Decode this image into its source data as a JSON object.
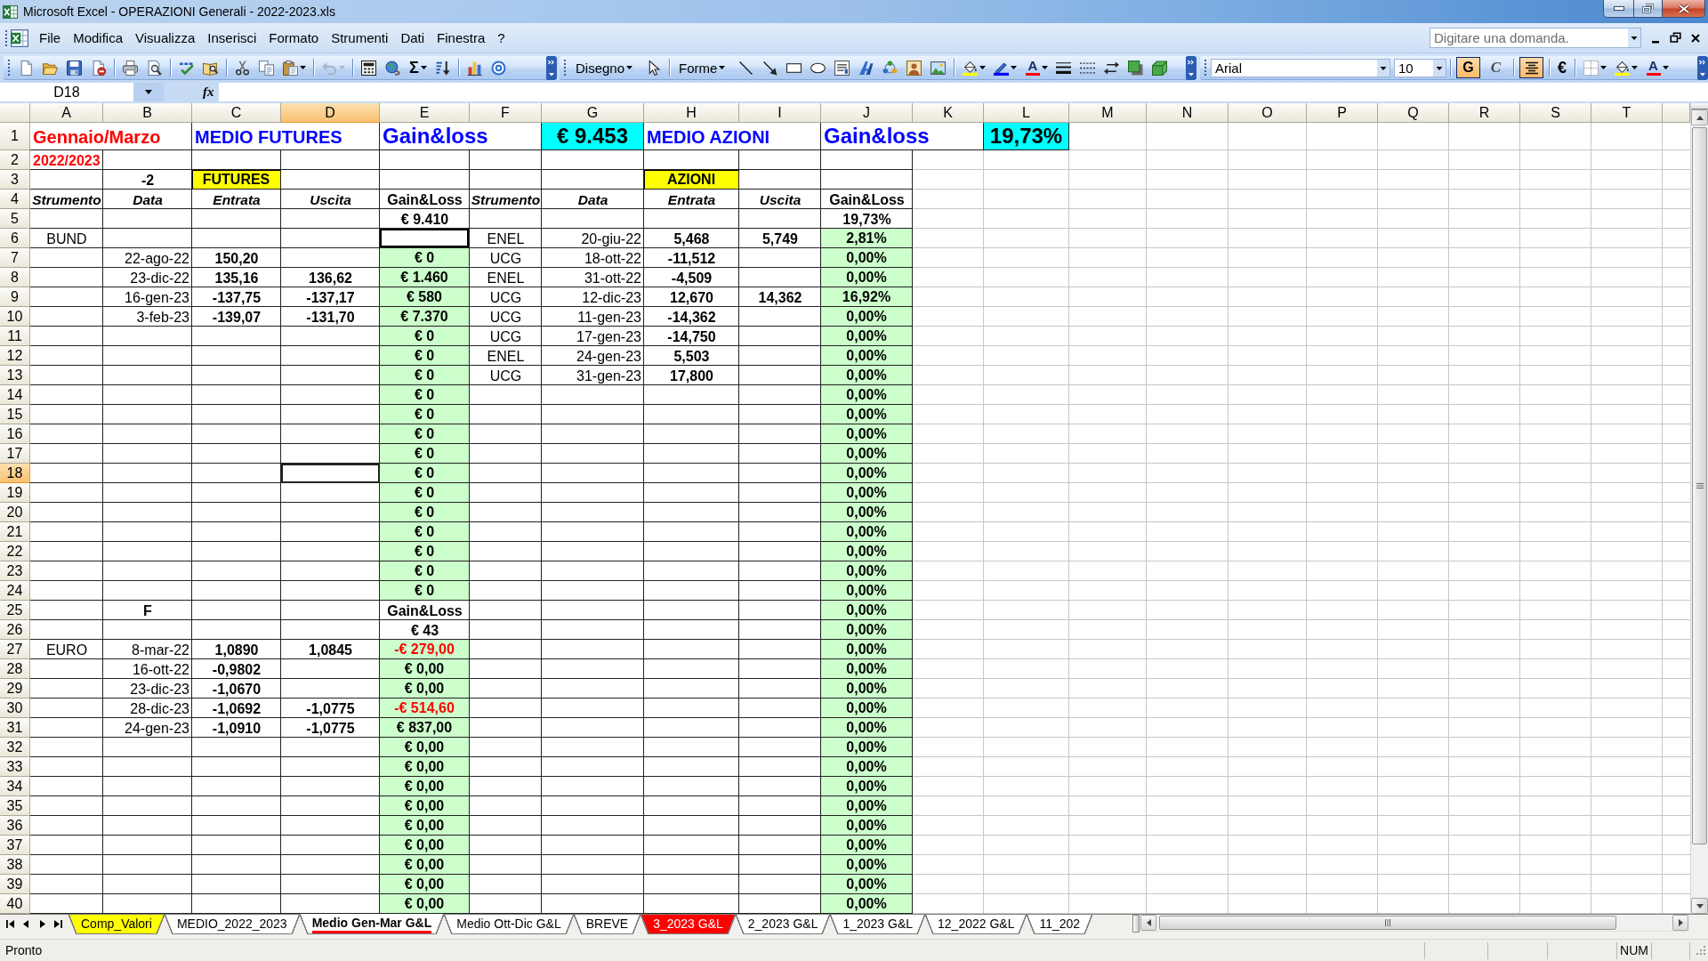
{
  "window": {
    "title": "Microsoft Excel - OPERAZIONI Generali - 2022-2023.xls"
  },
  "menu": {
    "items": [
      "File",
      "Modifica",
      "Visualizza",
      "Inserisci",
      "Formato",
      "Strumenti",
      "Dati",
      "Finestra",
      "?"
    ],
    "help_search": {
      "placeholder": "Digitare una domanda."
    }
  },
  "toolbars": {
    "standard": {
      "undo": {
        "disabled": true
      },
      "sum": "Σ"
    },
    "drawing": {
      "draw_menu": "Disegno",
      "shapes_menu": "Forme",
      "font_color": "A"
    },
    "formatting": {
      "font": "Arial",
      "font_size": "10",
      "bold": {
        "label": "G",
        "on": true
      },
      "italic": {
        "label": "C",
        "on": false
      },
      "center": {
        "on": true
      },
      "currency": "€",
      "font_color": "A"
    }
  },
  "formula_bar": {
    "name_box": "D18",
    "function_label": "fx"
  },
  "sheet": {
    "columns": [
      {
        "label": "A",
        "selected": false
      },
      {
        "label": "B",
        "selected": false
      },
      {
        "label": "C",
        "selected": false
      },
      {
        "label": "D",
        "selected": true
      },
      {
        "label": "E",
        "selected": false
      },
      {
        "label": "F",
        "selected": false
      },
      {
        "label": "G",
        "selected": false
      },
      {
        "label": "H",
        "selected": false
      },
      {
        "label": "I",
        "selected": false
      },
      {
        "label": "J",
        "selected": false
      },
      {
        "label": "K",
        "selected": false
      },
      {
        "label": "L",
        "selected": false
      },
      {
        "label": "M",
        "selected": false
      },
      {
        "label": "N",
        "selected": false
      },
      {
        "label": "O",
        "selected": false
      },
      {
        "label": "P",
        "selected": false
      },
      {
        "label": "Q",
        "selected": false
      },
      {
        "label": "R",
        "selected": false
      },
      {
        "label": "S",
        "selected": false
      },
      {
        "label": "T",
        "selected": false
      }
    ],
    "rows": [
      {
        "label": "1",
        "selected": false,
        "cells": [
          {
            "kind": "period",
            "text": "Gennaio/Marzo"
          },
          "",
          {
            "kind": "section",
            "text": "MEDIO FUTURES"
          },
          "",
          {
            "kind": "gainloss",
            "text": "Gain&loss"
          },
          "",
          {
            "kind": "total",
            "text": "€ 9.453"
          },
          {
            "kind": "section",
            "text": "MEDIO AZIONI"
          },
          "",
          {
            "kind": "gainloss",
            "text": "Gain&loss"
          },
          "",
          {
            "kind": "total",
            "text": "19,73%"
          }
        ]
      },
      {
        "label": "2",
        "selected": false,
        "cells": [
          {
            "kind": "year",
            "text": "2022/2023"
          }
        ]
      },
      {
        "label": "3",
        "selected": false,
        "cells": [
          "",
          {
            "kind": "label",
            "text": "-2"
          },
          {
            "kind": "tag",
            "text": "FUTURES"
          },
          "",
          "",
          "",
          "",
          {
            "kind": "tag",
            "text": "AZIONI"
          }
        ]
      },
      {
        "label": "4",
        "selected": false,
        "cells": [
          {
            "kind": "heading",
            "text": "Strumento"
          },
          {
            "kind": "heading",
            "text": "Data"
          },
          {
            "kind": "heading",
            "text": "Entrata"
          },
          {
            "kind": "heading",
            "text": "Uscita"
          },
          {
            "kind": "label",
            "text": "Gain&Loss"
          },
          {
            "kind": "heading",
            "text": "Strumento"
          },
          {
            "kind": "heading",
            "text": "Data"
          },
          {
            "kind": "heading",
            "text": "Entrata"
          },
          {
            "kind": "heading",
            "text": "Uscita"
          },
          {
            "kind": "label",
            "text": "Gain&Loss"
          }
        ]
      },
      {
        "label": "5",
        "selected": false,
        "cells": [
          "",
          "",
          "",
          "",
          {
            "kind": "label",
            "text": "€ 9.410"
          },
          "",
          "",
          "",
          "",
          {
            "kind": "label",
            "text": "19,73%"
          }
        ]
      },
      {
        "label": "6",
        "selected": false,
        "cells": [
          {
            "kind": "text",
            "text": "BUND"
          },
          "",
          "",
          "",
          {
            "kind": "frame"
          },
          {
            "kind": "text",
            "text": "ENEL"
          },
          {
            "kind": "date",
            "text": "20-giu-22"
          },
          {
            "kind": "number",
            "text": "5,468"
          },
          {
            "kind": "number",
            "text": "5,749"
          },
          {
            "kind": "percent",
            "text": "2,81%"
          }
        ]
      },
      {
        "label": "7",
        "selected": false,
        "cells": [
          "",
          {
            "kind": "date",
            "text": "22-ago-22"
          },
          {
            "kind": "number",
            "text": "150,20"
          },
          "",
          {
            "kind": "gain",
            "text": "€ 0"
          },
          {
            "kind": "text",
            "text": "UCG"
          },
          {
            "kind": "date",
            "text": "18-ott-22"
          },
          {
            "kind": "number",
            "text": "-11,512"
          },
          "",
          {
            "kind": "percent",
            "text": "0,00%"
          }
        ]
      },
      {
        "label": "8",
        "selected": false,
        "cells": [
          "",
          {
            "kind": "date",
            "text": "23-dic-22"
          },
          {
            "kind": "number",
            "text": "135,16"
          },
          {
            "kind": "number",
            "text": "136,62"
          },
          {
            "kind": "gain",
            "text": "€ 1.460"
          },
          {
            "kind": "text",
            "text": "ENEL"
          },
          {
            "kind": "date",
            "text": "31-ott-22"
          },
          {
            "kind": "number",
            "text": "-4,509"
          },
          "",
          {
            "kind": "percent",
            "text": "0,00%"
          }
        ]
      },
      {
        "label": "9",
        "selected": false,
        "cells": [
          "",
          {
            "kind": "date",
            "text": "16-gen-23"
          },
          {
            "kind": "number",
            "text": "-137,75"
          },
          {
            "kind": "number",
            "text": "-137,17"
          },
          {
            "kind": "gain",
            "text": "€ 580"
          },
          {
            "kind": "text",
            "text": "UCG"
          },
          {
            "kind": "date",
            "text": "12-dic-23"
          },
          {
            "kind": "number",
            "text": "12,670"
          },
          {
            "kind": "number",
            "text": "14,362"
          },
          {
            "kind": "percent",
            "text": "16,92%"
          }
        ]
      },
      {
        "label": "10",
        "selected": false,
        "cells": [
          "",
          {
            "kind": "date",
            "text": "3-feb-23"
          },
          {
            "kind": "number",
            "text": "-139,07"
          },
          {
            "kind": "number",
            "text": "-131,70"
          },
          {
            "kind": "gain",
            "text": "€ 7.370"
          },
          {
            "kind": "text",
            "text": "UCG"
          },
          {
            "kind": "date",
            "text": "11-gen-23"
          },
          {
            "kind": "number",
            "text": "-14,362"
          },
          "",
          {
            "kind": "percent",
            "text": "0,00%"
          }
        ]
      },
      {
        "label": "11",
        "selected": false,
        "cells": [
          "",
          "",
          "",
          "",
          {
            "kind": "gain",
            "text": "€ 0"
          },
          {
            "kind": "text",
            "text": "UCG"
          },
          {
            "kind": "date",
            "text": "17-gen-23"
          },
          {
            "kind": "number",
            "text": "-14,750"
          },
          "",
          {
            "kind": "percent",
            "text": "0,00%"
          }
        ]
      },
      {
        "label": "12",
        "selected": false,
        "cells": [
          "",
          "",
          "",
          "",
          {
            "kind": "gain",
            "text": "€ 0"
          },
          {
            "kind": "text",
            "text": "ENEL"
          },
          {
            "kind": "date",
            "text": "24-gen-23"
          },
          {
            "kind": "number",
            "text": "5,503"
          },
          "",
          {
            "kind": "percent",
            "text": "0,00%"
          }
        ]
      },
      {
        "label": "13",
        "selected": false,
        "cells": [
          "",
          "",
          "",
          "",
          {
            "kind": "gain",
            "text": "€ 0"
          },
          {
            "kind": "text",
            "text": "UCG"
          },
          {
            "kind": "date",
            "text": "31-gen-23"
          },
          {
            "kind": "number",
            "text": "17,800"
          },
          "",
          {
            "kind": "percent",
            "text": "0,00%"
          }
        ]
      },
      {
        "label": "14",
        "selected": false,
        "cells": [
          "",
          "",
          "",
          "",
          {
            "kind": "gain",
            "text": "€ 0"
          },
          "",
          "",
          "",
          "",
          {
            "kind": "percent",
            "text": "0,00%"
          }
        ]
      },
      {
        "label": "15",
        "selected": false,
        "cells": [
          "",
          "",
          "",
          "",
          {
            "kind": "gain",
            "text": "€ 0"
          },
          "",
          "",
          "",
          "",
          {
            "kind": "percent",
            "text": "0,00%"
          }
        ]
      },
      {
        "label": "16",
        "selected": false,
        "cells": [
          "",
          "",
          "",
          "",
          {
            "kind": "gain",
            "text": "€ 0"
          },
          "",
          "",
          "",
          "",
          {
            "kind": "percent",
            "text": "0,00%"
          }
        ]
      },
      {
        "label": "17",
        "selected": false,
        "cells": [
          "",
          "",
          "",
          "",
          {
            "kind": "gain",
            "text": "€ 0"
          },
          "",
          "",
          "",
          "",
          {
            "kind": "percent",
            "text": "0,00%"
          }
        ]
      },
      {
        "label": "18",
        "selected": true,
        "cells": [
          "",
          "",
          "",
          "",
          {
            "kind": "gain",
            "text": "€ 0"
          },
          "",
          "",
          "",
          "",
          {
            "kind": "percent",
            "text": "0,00%"
          }
        ]
      },
      {
        "label": "19",
        "selected": false,
        "cells": [
          "",
          "",
          "",
          "",
          {
            "kind": "gain",
            "text": "€ 0"
          },
          "",
          "",
          "",
          "",
          {
            "kind": "percent",
            "text": "0,00%"
          }
        ]
      },
      {
        "label": "20",
        "selected": false,
        "cells": [
          "",
          "",
          "",
          "",
          {
            "kind": "gain",
            "text": "€ 0"
          },
          "",
          "",
          "",
          "",
          {
            "kind": "percent",
            "text": "0,00%"
          }
        ]
      },
      {
        "label": "21",
        "selected": false,
        "cells": [
          "",
          "",
          "",
          "",
          {
            "kind": "gain",
            "text": "€ 0"
          },
          "",
          "",
          "",
          "",
          {
            "kind": "percent",
            "text": "0,00%"
          }
        ]
      },
      {
        "label": "22",
        "selected": false,
        "cells": [
          "",
          "",
          "",
          "",
          {
            "kind": "gain",
            "text": "€ 0"
          },
          "",
          "",
          "",
          "",
          {
            "kind": "percent",
            "text": "0,00%"
          }
        ]
      },
      {
        "label": "23",
        "selected": false,
        "cells": [
          "",
          "",
          "",
          "",
          {
            "kind": "gain",
            "text": "€ 0"
          },
          "",
          "",
          "",
          "",
          {
            "kind": "percent",
            "text": "0,00%"
          }
        ]
      },
      {
        "label": "24",
        "selected": false,
        "cells": [
          "",
          "",
          "",
          "",
          {
            "kind": "gain",
            "text": "€ 0"
          },
          "",
          "",
          "",
          "",
          {
            "kind": "percent",
            "text": "0,00%"
          }
        ]
      },
      {
        "label": "25",
        "selected": false,
        "cells": [
          "",
          {
            "kind": "label",
            "text": "F"
          },
          "",
          "",
          {
            "kind": "label",
            "text": "Gain&Loss"
          },
          "",
          "",
          "",
          "",
          {
            "kind": "percent",
            "text": "0,00%"
          }
        ]
      },
      {
        "label": "26",
        "selected": false,
        "cells": [
          "",
          "",
          "",
          "",
          {
            "kind": "label",
            "text": "€ 43"
          },
          "",
          "",
          "",
          "",
          {
            "kind": "percent",
            "text": "0,00%"
          }
        ]
      },
      {
        "label": "27",
        "selected": false,
        "cells": [
          {
            "kind": "text",
            "text": "EURO"
          },
          {
            "kind": "date",
            "text": "8-mar-22"
          },
          {
            "kind": "number",
            "text": "1,0890"
          },
          {
            "kind": "number",
            "text": "1,0845"
          },
          {
            "kind": "loss",
            "text": "-€ 279,00"
          },
          "",
          "",
          "",
          "",
          {
            "kind": "percent",
            "text": "0,00%"
          }
        ]
      },
      {
        "label": "28",
        "selected": false,
        "cells": [
          "",
          {
            "kind": "date",
            "text": "16-ott-22"
          },
          {
            "kind": "number",
            "text": "-0,9802"
          },
          "",
          {
            "kind": "gain",
            "text": "€ 0,00"
          },
          "",
          "",
          "",
          "",
          {
            "kind": "percent",
            "text": "0,00%"
          }
        ]
      },
      {
        "label": "29",
        "selected": false,
        "cells": [
          "",
          {
            "kind": "date",
            "text": "23-dic-23"
          },
          {
            "kind": "number",
            "text": "-1,0670"
          },
          "",
          {
            "kind": "gain",
            "text": "€ 0,00"
          },
          "",
          "",
          "",
          "",
          {
            "kind": "percent",
            "text": "0,00%"
          }
        ]
      },
      {
        "label": "30",
        "selected": false,
        "cells": [
          "",
          {
            "kind": "date",
            "text": "28-dic-23"
          },
          {
            "kind": "number",
            "text": "-1,0692"
          },
          {
            "kind": "number",
            "text": "-1,0775"
          },
          {
            "kind": "loss",
            "text": "-€ 514,60"
          },
          "",
          "",
          "",
          "",
          {
            "kind": "percent",
            "text": "0,00%"
          }
        ]
      },
      {
        "label": "31",
        "selected": false,
        "cells": [
          "",
          {
            "kind": "date",
            "text": "24-gen-23"
          },
          {
            "kind": "number",
            "text": "-1,0910"
          },
          {
            "kind": "number",
            "text": "-1,0775"
          },
          {
            "kind": "gain",
            "text": "€ 837,00"
          },
          "",
          "",
          "",
          "",
          {
            "kind": "percent",
            "text": "0,00%"
          }
        ]
      },
      {
        "label": "32",
        "selected": false,
        "cells": [
          "",
          "",
          "",
          "",
          {
            "kind": "gain",
            "text": "€ 0,00"
          },
          "",
          "",
          "",
          "",
          {
            "kind": "percent",
            "text": "0,00%"
          }
        ]
      },
      {
        "label": "33",
        "selected": false,
        "cells": [
          "",
          "",
          "",
          "",
          {
            "kind": "gain",
            "text": "€ 0,00"
          },
          "",
          "",
          "",
          "",
          {
            "kind": "percent",
            "text": "0,00%"
          }
        ]
      },
      {
        "label": "34",
        "selected": false,
        "cells": [
          "",
          "",
          "",
          "",
          {
            "kind": "gain",
            "text": "€ 0,00"
          },
          "",
          "",
          "",
          "",
          {
            "kind": "percent",
            "text": "0,00%"
          }
        ]
      },
      {
        "label": "35",
        "selected": false,
        "cells": [
          "",
          "",
          "",
          "",
          {
            "kind": "gain",
            "text": "€ 0,00"
          },
          "",
          "",
          "",
          "",
          {
            "kind": "percent",
            "text": "0,00%"
          }
        ]
      },
      {
        "label": "36",
        "selected": false,
        "cells": [
          "",
          "",
          "",
          "",
          {
            "kind": "gain",
            "text": "€ 0,00"
          },
          "",
          "",
          "",
          "",
          {
            "kind": "percent",
            "text": "0,00%"
          }
        ]
      },
      {
        "label": "37",
        "selected": false,
        "cells": [
          "",
          "",
          "",
          "",
          {
            "kind": "gain",
            "text": "€ 0,00"
          },
          "",
          "",
          "",
          "",
          {
            "kind": "percent",
            "text": "0,00%"
          }
        ]
      },
      {
        "label": "38",
        "selected": false,
        "cells": [
          "",
          "",
          "",
          "",
          {
            "kind": "gain",
            "text": "€ 0,00"
          },
          "",
          "",
          "",
          "",
          {
            "kind": "percent",
            "text": "0,00%"
          }
        ]
      },
      {
        "label": "39",
        "selected": false,
        "cells": [
          "",
          "",
          "",
          "",
          {
            "kind": "gain",
            "text": "€ 0,00"
          },
          "",
          "",
          "",
          "",
          {
            "kind": "percent",
            "text": "0,00%"
          }
        ]
      },
      {
        "label": "40",
        "selected": false,
        "cells": [
          "",
          "",
          "",
          "",
          {
            "kind": "gain",
            "text": "€ 0,00"
          },
          "",
          "",
          "",
          "",
          {
            "kind": "percent",
            "text": "0,00%"
          }
        ]
      }
    ]
  },
  "sheet_tabs": [
    {
      "label": "Comp_Valori",
      "selected": false,
      "color": "#ffff00"
    },
    {
      "label": "MEDIO_2022_2023",
      "selected": false
    },
    {
      "label": "Medio Gen-Mar G&L",
      "selected": true,
      "color": "#ff0000"
    },
    {
      "label": "Medio Ott-Dic G&L",
      "selected": false
    },
    {
      "label": "BREVE",
      "selected": false
    },
    {
      "label": "3_2023 G&L",
      "selected": false,
      "color": "#ff0000"
    },
    {
      "label": "2_2023 G&L",
      "selected": false
    },
    {
      "label": "1_2023 G&L",
      "selected": false
    },
    {
      "label": "12_2022 G&L",
      "selected": false
    },
    {
      "label": "11_202",
      "selected": false
    }
  ],
  "status_bar": {
    "status": "Pronto",
    "indicator": "NUM"
  }
}
